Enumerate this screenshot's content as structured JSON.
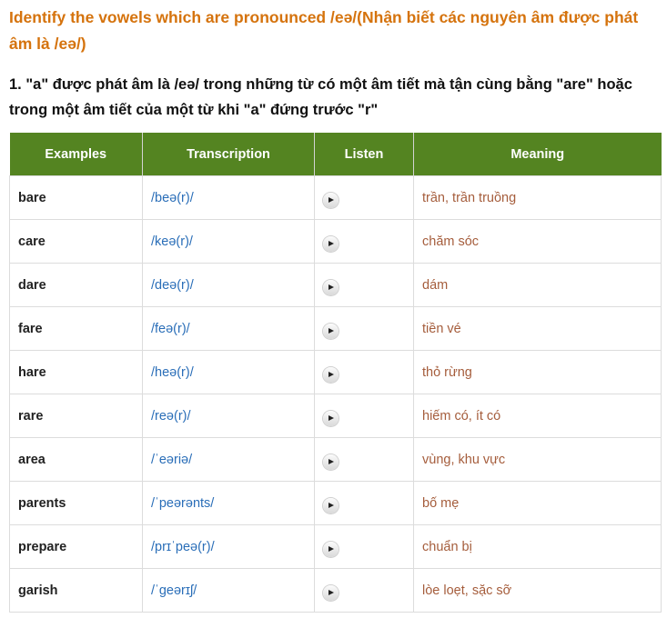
{
  "heading": "Identify the vowels which are pronounced /eə/(Nhận biết các nguyên âm được phát âm là /eə/)",
  "subheading": "1. \"a\" được phát âm là /eə/ trong những từ có một âm tiết mà tận cùng bằng \"are\" hoặc trong một âm tiết của một từ khi \"a\" đứng trước \"r\"",
  "colors": {
    "heading": "#d5730d",
    "header_bg": "#548421",
    "transcription": "#2a6eb8",
    "meaning": "#a55d3c"
  },
  "table": {
    "headers": {
      "examples": "Examples",
      "transcription": "Transcription",
      "listen": "Listen",
      "meaning": "Meaning"
    },
    "listen_icon": "play-icon",
    "rows": [
      {
        "example": "bare",
        "transcription": "/beə(r)/",
        "meaning": "trần, trần truồng"
      },
      {
        "example": "care",
        "transcription": "/keə(r)/",
        "meaning": "chăm sóc"
      },
      {
        "example": "dare",
        "transcription": "/deə(r)/",
        "meaning": "dám"
      },
      {
        "example": "fare",
        "transcription": "/feə(r)/",
        "meaning": "tiền vé"
      },
      {
        "example": "hare",
        "transcription": "/heə(r)/",
        "meaning": "thỏ rừng"
      },
      {
        "example": "rare",
        "transcription": "/reə(r)/",
        "meaning": "hiếm có, ít có"
      },
      {
        "example": "area",
        "transcription": "/ˈeəriə/",
        "meaning": "vùng, khu vực"
      },
      {
        "example": "parents",
        "transcription": "/ˈpeərənts/",
        "meaning": "bố mẹ"
      },
      {
        "example": "prepare",
        "transcription": "/prɪˈpeə(r)/",
        "meaning": "chuẩn bị"
      },
      {
        "example": "garish",
        "transcription": "/ˈgeərɪʃ/",
        "meaning": "lòe loẹt, sặc sỡ"
      }
    ]
  }
}
